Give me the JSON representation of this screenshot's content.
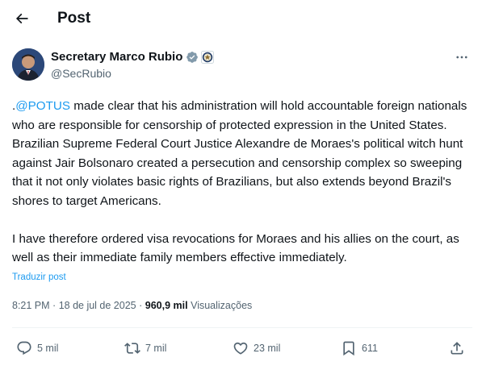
{
  "header": {
    "title": "Post"
  },
  "author": {
    "name": "Secretary Marco Rubio",
    "handle": "@SecRubio"
  },
  "tweet": {
    "prefix": ".",
    "mention": "@POTUS",
    "paragraph_1_rest": " made clear that his administration will hold accountable foreign nationals who are responsible for censorship of protected expression in the United States. Brazilian Supreme Federal Court Justice Alexandre de Moraes's political witch hunt against Jair Bolsonaro created a persecution and censorship complex so sweeping that it not only violates basic rights of Brazilians, but also extends beyond Brazil's shores to target Americans.",
    "paragraph_2": "I have therefore ordered visa revocations for Moraes and his allies on the court, as well as their immediate family members effective immediately.",
    "translate_label": "Traduzir post"
  },
  "meta": {
    "time": "8:21 PM",
    "separator_1": "·",
    "date": "18 de jul de 2025",
    "separator_2": "·",
    "views_count": "960,9 mil",
    "views_label": "Visualizações"
  },
  "actions": {
    "replies": "5 mil",
    "reposts": "7 mil",
    "likes": "23 mil",
    "bookmarks": "611"
  },
  "icons": {
    "back": "arrow-left-icon",
    "verified": "verified-badge-icon",
    "affiliate": "government-seal-icon",
    "more": "more-options-icon",
    "reply": "reply-icon",
    "repost": "repost-icon",
    "like": "heart-icon",
    "bookmark": "bookmark-icon",
    "share": "share-icon"
  },
  "colors": {
    "accent": "#1d9bf0",
    "text": "#0f1419",
    "secondary": "#536471",
    "verified_badge": "#829aab"
  }
}
